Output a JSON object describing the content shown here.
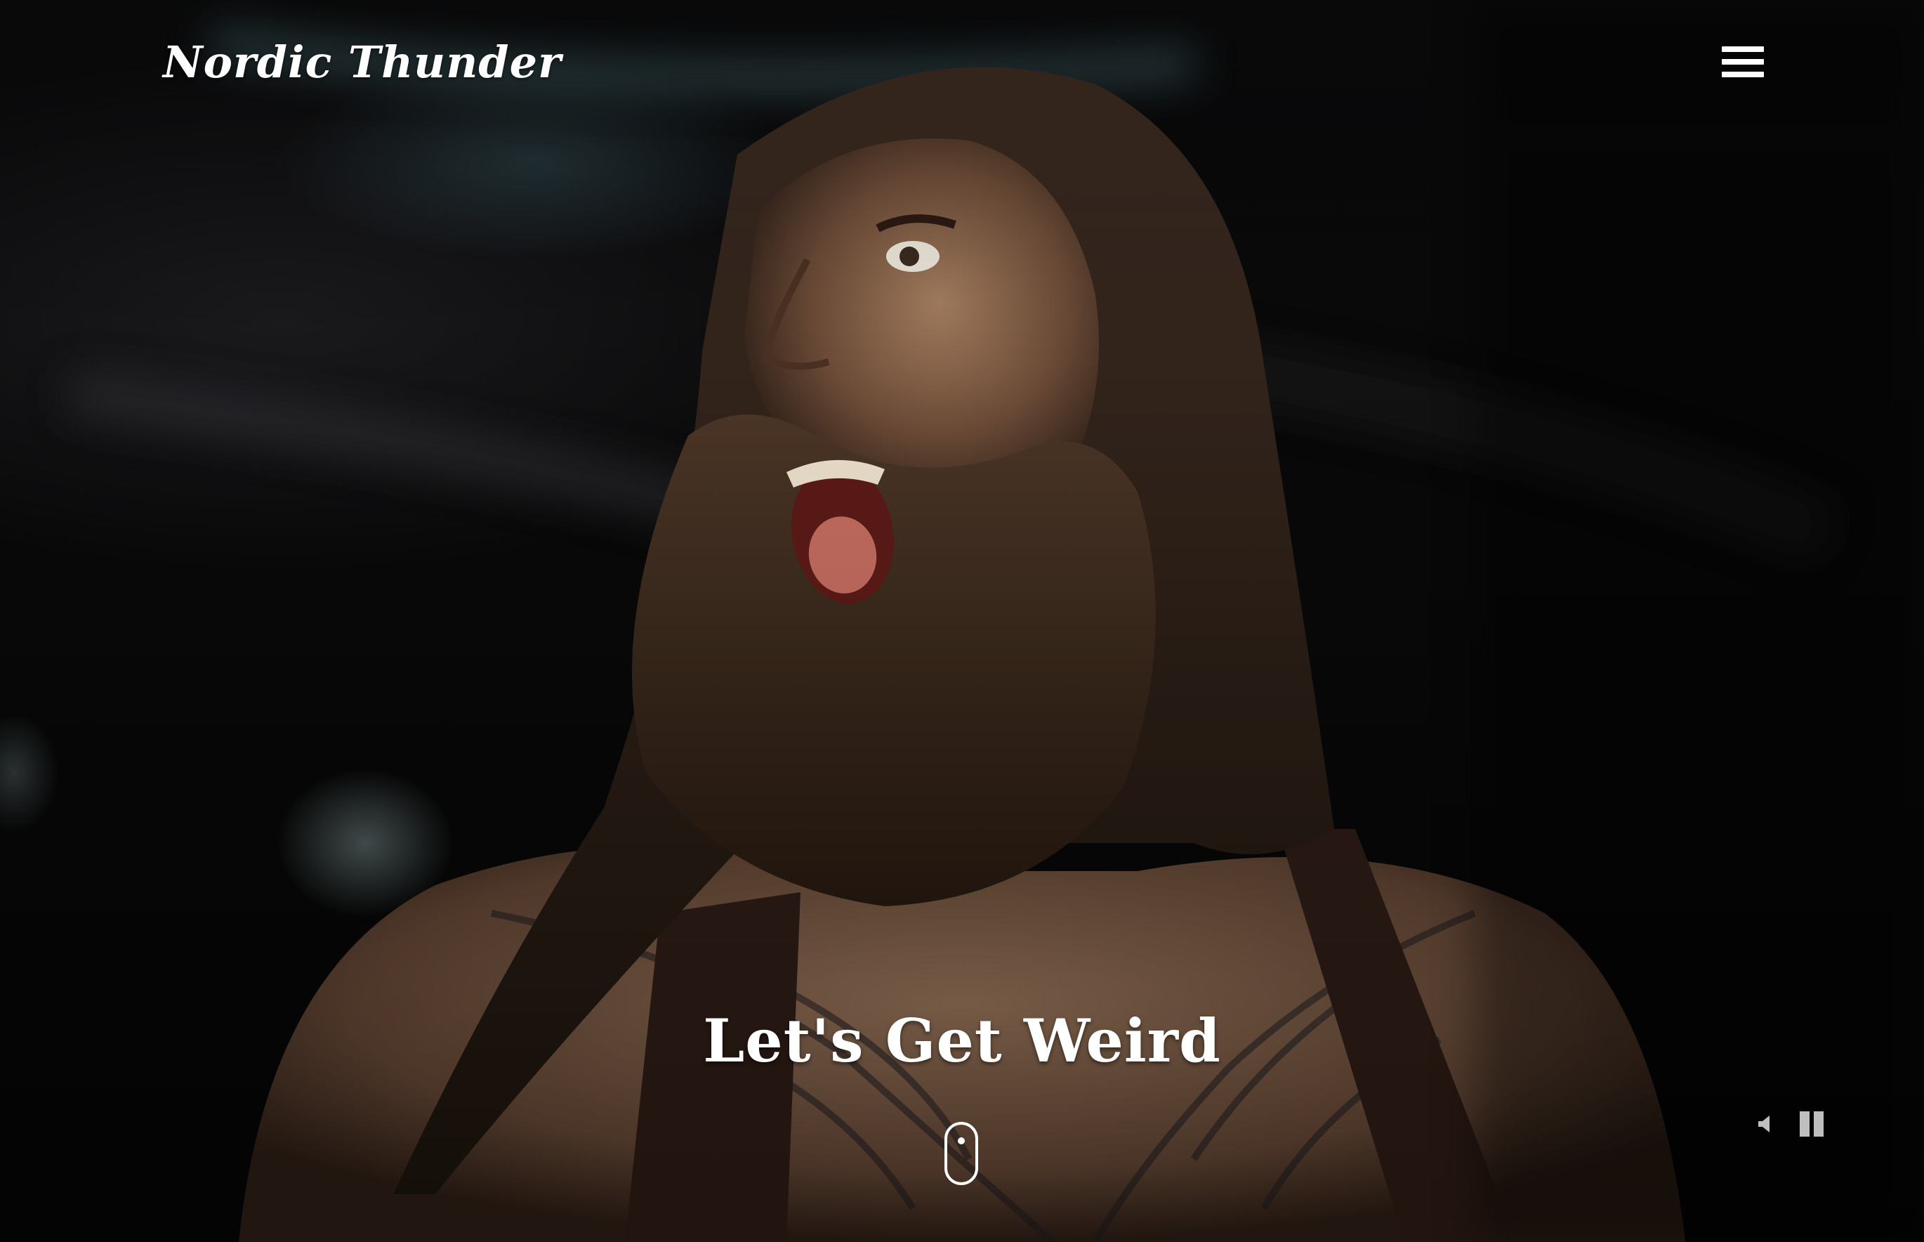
{
  "header": {
    "brand": "Nordic Thunder",
    "menu_icon": "hamburger-menu-icon"
  },
  "hero": {
    "headline": "Let's Get Weird",
    "scroll_icon": "mouse-scroll-icon",
    "background": "concert-photo-screaming-bearded-performer"
  },
  "media_controls": {
    "mute_icon": "volume-icon",
    "pause_icon": "pause-icon"
  },
  "colors": {
    "text": "#ffffff",
    "background": "#070707",
    "controls": "#bfbfbf"
  }
}
